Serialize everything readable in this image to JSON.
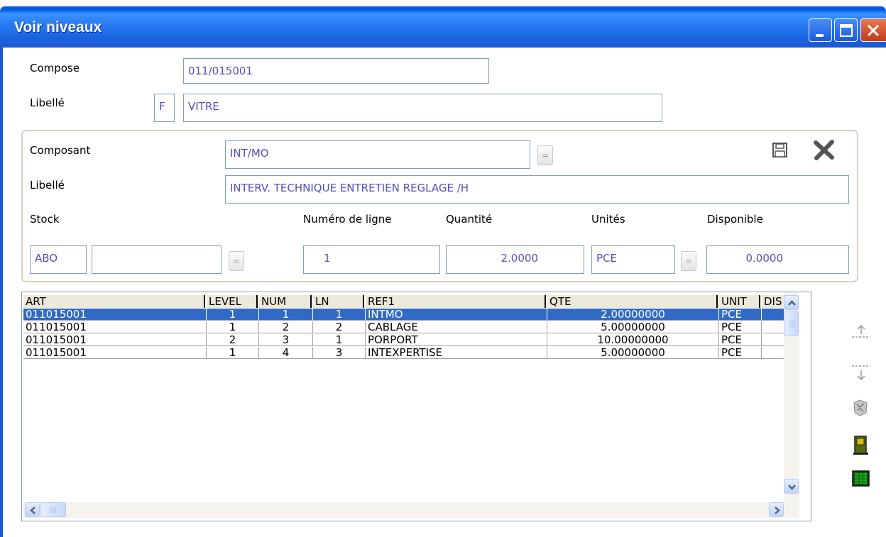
{
  "window": {
    "title": "Voir niveaux"
  },
  "header": {
    "compose_label": "Compose",
    "compose_value": "011/015001",
    "libelle_label": "Libellé",
    "libelle_code": "F",
    "libelle_value": "VITRE"
  },
  "composant": {
    "composant_label": "Composant",
    "composant_value": "INT/MO",
    "lookup_label": "=",
    "libelle_label": "Libellé",
    "libelle_value": "INTERV. TECHNIQUE ENTRETIEN REGLAGE /H",
    "stock_label": "Stock",
    "stock_code": "ABO",
    "stock_name": "",
    "numero_label": "Numéro de ligne",
    "numero_value": "1",
    "quantite_label": "Quantité",
    "quantite_value": "2.0000",
    "unites_label": "Unités",
    "unites_value": "PCE",
    "disponible_label": "Disponible",
    "disponible_value": "0.0000"
  },
  "grid": {
    "columns": [
      "ART",
      "LEVEL",
      "NUM",
      "LN",
      "REF1",
      "QTE",
      "UNIT",
      "DIS"
    ],
    "rows": [
      {
        "art": "011015001",
        "level": "1",
        "num": "1",
        "ln": "1",
        "ref1": "INTMO",
        "qte": "2.00000000",
        "unit": "PCE",
        "dis": ""
      },
      {
        "art": "011015001",
        "level": "1",
        "num": "2",
        "ln": "2",
        "ref1": "CABLAGE",
        "qte": "5.00000000",
        "unit": "PCE",
        "dis": ""
      },
      {
        "art": "011015001",
        "level": "2",
        "num": "3",
        "ln": "1",
        "ref1": "PORPORT",
        "qte": "10.00000000",
        "unit": "PCE",
        "dis": ""
      },
      {
        "art": "011015001",
        "level": "1",
        "num": "4",
        "ln": "3",
        "ref1": "INTEXPERTISE",
        "qte": "5.00000000",
        "unit": "PCE",
        "dis": ""
      }
    ],
    "selected_row": 0
  },
  "icons": {
    "save": "save-icon",
    "cancel": "cancel-x-icon",
    "move_up": "move-up-icon",
    "move_down": "move-down-icon",
    "recycle": "recycle-icon",
    "exit": "exit-door-icon",
    "spreadsheet": "spreadsheet-icon"
  },
  "colors": {
    "titlebar": "#2a7df5",
    "field_text": "#5050c0",
    "selection": "#316ac5",
    "close_button": "#d4492a"
  }
}
